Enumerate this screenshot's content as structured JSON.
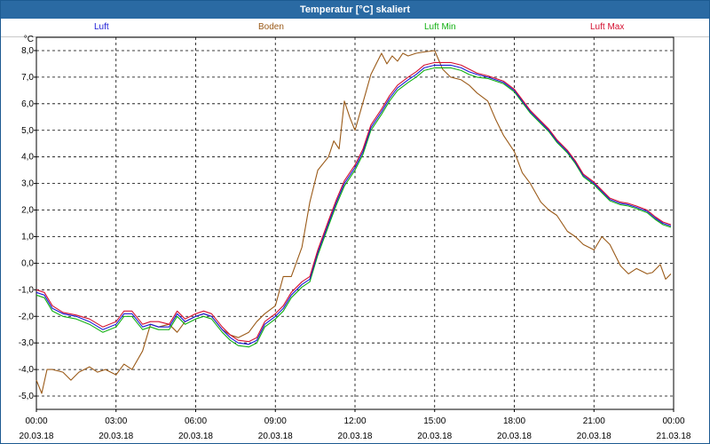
{
  "window": {
    "title": "Temperatur [°C] skaliert"
  },
  "legend": [
    {
      "name": "Luft",
      "color": "#1a1ad6"
    },
    {
      "name": "Boden",
      "color": "#9a5a18"
    },
    {
      "name": "Luft Min",
      "color": "#12b012"
    },
    {
      "name": "Luft Max",
      "color": "#d41030"
    }
  ],
  "chart_data": {
    "type": "line",
    "title": "Temperatur [°C] skaliert",
    "ylabel": "°C",
    "xlabel": "",
    "ylim": [
      -5.5,
      8.5
    ],
    "yticks": [
      "8,0",
      "7,0",
      "6,0",
      "5,0",
      "4,0",
      "3,0",
      "2,0",
      "1,0",
      "0,0",
      "-1,0",
      "-2,0",
      "-3,0",
      "-4,0",
      "-5,0"
    ],
    "x_hours_range": [
      0,
      24
    ],
    "xticks": [
      {
        "time": "00:00",
        "date": "20.03.18"
      },
      {
        "time": "03:00",
        "date": "20.03.18"
      },
      {
        "time": "06:00",
        "date": "20.03.18"
      },
      {
        "time": "09:00",
        "date": "20.03.18"
      },
      {
        "time": "12:00",
        "date": "20.03.18"
      },
      {
        "time": "15:00",
        "date": "20.03.18"
      },
      {
        "time": "18:00",
        "date": "20.03.18"
      },
      {
        "time": "21:00",
        "date": "20.03.18"
      },
      {
        "time": "00:00",
        "date": "21.03.18"
      }
    ],
    "grid": true,
    "legend_position": "top",
    "series": [
      {
        "name": "Luft",
        "x": [
          0,
          0.3,
          0.6,
          1,
          1.5,
          2,
          2.5,
          3,
          3.3,
          3.6,
          4,
          4.3,
          4.6,
          5,
          5.3,
          5.6,
          6,
          6.3,
          6.6,
          7,
          7.3,
          7.6,
          8,
          8.3,
          8.6,
          9,
          9.3,
          9.6,
          10,
          10.3,
          10.6,
          11,
          11.3,
          11.6,
          12,
          12.3,
          12.6,
          13,
          13.3,
          13.6,
          14,
          14.3,
          14.6,
          15,
          15.3,
          15.6,
          16,
          16.3,
          16.6,
          17,
          17.3,
          17.6,
          18,
          18.3,
          18.6,
          19,
          19.3,
          19.6,
          20,
          20.3,
          20.6,
          21,
          21.3,
          21.6,
          22,
          22.3,
          22.6,
          23,
          23.3,
          23.6,
          23.9
        ],
        "y": [
          -1.1,
          -1.2,
          -1.7,
          -1.9,
          -2.0,
          -2.2,
          -2.5,
          -2.3,
          -1.9,
          -1.9,
          -2.4,
          -2.3,
          -2.4,
          -2.4,
          -1.9,
          -2.2,
          -2.0,
          -1.9,
          -2.0,
          -2.5,
          -2.8,
          -3.0,
          -3.05,
          -2.9,
          -2.3,
          -2.0,
          -1.7,
          -1.2,
          -0.8,
          -0.6,
          0.4,
          1.5,
          2.3,
          3.0,
          3.6,
          4.2,
          5.1,
          5.7,
          6.2,
          6.6,
          6.9,
          7.1,
          7.35,
          7.45,
          7.45,
          7.45,
          7.35,
          7.2,
          7.1,
          7.0,
          6.9,
          6.8,
          6.5,
          6.1,
          5.7,
          5.3,
          5.0,
          4.6,
          4.2,
          3.8,
          3.3,
          3.0,
          2.7,
          2.4,
          2.25,
          2.2,
          2.1,
          1.95,
          1.7,
          1.5,
          1.4
        ]
      },
      {
        "name": "Boden",
        "x": [
          0,
          0.2,
          0.4,
          0.6,
          1,
          1.3,
          1.6,
          2,
          2.3,
          2.6,
          3,
          3.3,
          3.6,
          4,
          4.3,
          4.6,
          5,
          5.3,
          5.6,
          6,
          6.3,
          6.6,
          7,
          7.3,
          7.6,
          8,
          8.3,
          8.6,
          9,
          9.3,
          9.6,
          10,
          10.3,
          10.6,
          11,
          11.2,
          11.4,
          11.6,
          11.8,
          12,
          12.2,
          12.4,
          12.6,
          12.8,
          13,
          13.2,
          13.4,
          13.6,
          13.8,
          14,
          14.3,
          14.6,
          15,
          15.3,
          15.6,
          16,
          16.3,
          16.6,
          17,
          17.3,
          17.6,
          18,
          18.3,
          18.6,
          19,
          19.3,
          19.6,
          20,
          20.3,
          20.6,
          21,
          21.3,
          21.6,
          22,
          22.3,
          22.6,
          23,
          23.2,
          23.5,
          23.7,
          23.9
        ],
        "y": [
          -4.4,
          -4.9,
          -4.0,
          -4.0,
          -4.1,
          -4.4,
          -4.1,
          -3.9,
          -4.1,
          -4.0,
          -4.2,
          -3.8,
          -4.0,
          -3.3,
          -2.3,
          -2.4,
          -2.3,
          -2.6,
          -2.2,
          -2.0,
          -1.9,
          -2.0,
          -2.5,
          -2.7,
          -2.8,
          -2.6,
          -2.2,
          -1.9,
          -1.6,
          -0.5,
          -0.5,
          0.6,
          2.3,
          3.5,
          4.0,
          4.6,
          4.3,
          6.1,
          5.5,
          5.0,
          5.7,
          6.4,
          7.1,
          7.5,
          7.9,
          7.5,
          7.8,
          7.6,
          7.9,
          7.8,
          7.9,
          7.95,
          8.0,
          7.3,
          7.0,
          6.9,
          6.7,
          6.4,
          6.1,
          5.4,
          4.8,
          4.2,
          3.4,
          3.0,
          2.3,
          2.0,
          1.8,
          1.2,
          1.0,
          0.7,
          0.5,
          1.0,
          0.7,
          -0.1,
          -0.4,
          -0.2,
          -0.4,
          -0.35,
          -0.05,
          -0.6,
          -0.4
        ]
      },
      {
        "name": "Luft Min",
        "x": [
          0,
          0.3,
          0.6,
          1,
          1.5,
          2,
          2.5,
          3,
          3.3,
          3.6,
          4,
          4.3,
          4.6,
          5,
          5.3,
          5.6,
          6,
          6.3,
          6.6,
          7,
          7.3,
          7.6,
          8,
          8.3,
          8.6,
          9,
          9.3,
          9.6,
          10,
          10.3,
          10.6,
          11,
          11.3,
          11.6,
          12,
          12.3,
          12.6,
          13,
          13.3,
          13.6,
          14,
          14.3,
          14.6,
          15,
          15.3,
          15.6,
          16,
          16.3,
          16.6,
          17,
          17.3,
          17.6,
          18,
          18.3,
          18.6,
          19,
          19.3,
          19.6,
          20,
          20.3,
          20.6,
          21,
          21.3,
          21.6,
          22,
          22.3,
          22.6,
          23,
          23.3,
          23.6,
          23.9
        ],
        "y": [
          -1.2,
          -1.3,
          -1.8,
          -2.0,
          -2.1,
          -2.3,
          -2.6,
          -2.4,
          -2.0,
          -2.0,
          -2.5,
          -2.4,
          -2.5,
          -2.5,
          -2.0,
          -2.3,
          -2.1,
          -2.0,
          -2.1,
          -2.6,
          -2.9,
          -3.1,
          -3.15,
          -3.0,
          -2.4,
          -2.1,
          -1.8,
          -1.3,
          -0.9,
          -0.7,
          0.3,
          1.4,
          2.2,
          2.9,
          3.5,
          4.1,
          5.0,
          5.6,
          6.1,
          6.5,
          6.8,
          7.0,
          7.25,
          7.35,
          7.35,
          7.35,
          7.25,
          7.1,
          7.0,
          6.95,
          6.85,
          6.75,
          6.45,
          6.05,
          5.65,
          5.25,
          4.95,
          4.55,
          4.15,
          3.75,
          3.25,
          2.95,
          2.65,
          2.35,
          2.2,
          2.15,
          2.05,
          1.9,
          1.65,
          1.45,
          1.35
        ]
      },
      {
        "name": "Luft Max",
        "x": [
          0,
          0.3,
          0.6,
          1,
          1.5,
          2,
          2.5,
          3,
          3.3,
          3.6,
          4,
          4.3,
          4.6,
          5,
          5.3,
          5.6,
          6,
          6.3,
          6.6,
          7,
          7.3,
          7.6,
          8,
          8.3,
          8.6,
          9,
          9.3,
          9.6,
          10,
          10.3,
          10.6,
          11,
          11.3,
          11.6,
          12,
          12.3,
          12.6,
          13,
          13.3,
          13.6,
          14,
          14.3,
          14.6,
          15,
          15.3,
          15.6,
          16,
          16.3,
          16.6,
          17,
          17.3,
          17.6,
          18,
          18.3,
          18.6,
          19,
          19.3,
          19.6,
          20,
          20.3,
          20.6,
          21,
          21.3,
          21.6,
          22,
          22.3,
          22.6,
          23,
          23.3,
          23.6,
          23.9
        ],
        "y": [
          -1.0,
          -1.1,
          -1.6,
          -1.85,
          -1.95,
          -2.1,
          -2.4,
          -2.2,
          -1.8,
          -1.8,
          -2.3,
          -2.2,
          -2.2,
          -2.3,
          -1.8,
          -2.1,
          -1.9,
          -1.8,
          -1.9,
          -2.4,
          -2.7,
          -2.9,
          -2.95,
          -2.8,
          -2.2,
          -1.9,
          -1.6,
          -1.1,
          -0.7,
          -0.5,
          0.5,
          1.6,
          2.4,
          3.1,
          3.7,
          4.3,
          5.2,
          5.8,
          6.3,
          6.7,
          7.0,
          7.2,
          7.45,
          7.55,
          7.55,
          7.55,
          7.45,
          7.3,
          7.15,
          7.05,
          6.95,
          6.85,
          6.55,
          6.15,
          5.75,
          5.35,
          5.05,
          4.65,
          4.25,
          3.85,
          3.35,
          3.05,
          2.75,
          2.45,
          2.3,
          2.25,
          2.15,
          2.0,
          1.75,
          1.55,
          1.45
        ]
      }
    ]
  }
}
